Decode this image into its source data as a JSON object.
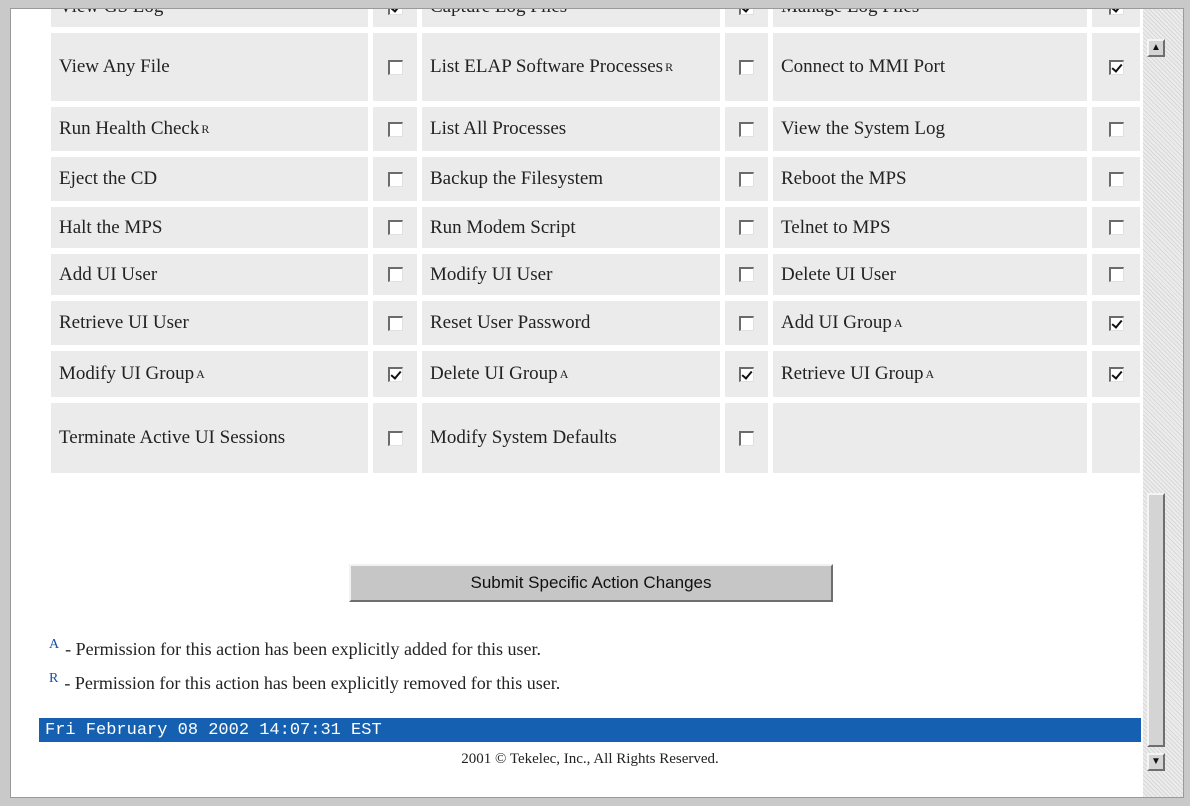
{
  "permissions": [
    [
      {
        "label": "View GS Log",
        "mark": "",
        "checked": true
      },
      {
        "label": "Capture Log Files",
        "mark": "",
        "checked": true
      },
      {
        "label": "Manage Log Files",
        "mark": "",
        "checked": true
      }
    ],
    [
      {
        "label": "View Any File",
        "mark": "",
        "checked": false
      },
      {
        "label": "List ELAP Software Processes",
        "mark": "R",
        "checked": false
      },
      {
        "label": "Connect to MMI Port",
        "mark": "",
        "checked": true
      }
    ],
    [
      {
        "label": "Run Health Check",
        "mark": "R",
        "checked": false
      },
      {
        "label": "List All Processes",
        "mark": "",
        "checked": false
      },
      {
        "label": "View the System Log",
        "mark": "",
        "checked": false
      }
    ],
    [
      {
        "label": "Eject the CD",
        "mark": "",
        "checked": false
      },
      {
        "label": "Backup the Filesystem",
        "mark": "",
        "checked": false
      },
      {
        "label": "Reboot the MPS",
        "mark": "",
        "checked": false
      }
    ],
    [
      {
        "label": "Halt the MPS",
        "mark": "",
        "checked": false
      },
      {
        "label": "Run Modem Script",
        "mark": "",
        "checked": false
      },
      {
        "label": "Telnet to MPS",
        "mark": "",
        "checked": false
      }
    ],
    [
      {
        "label": "Add UI User",
        "mark": "",
        "checked": false
      },
      {
        "label": "Modify UI User",
        "mark": "",
        "checked": false
      },
      {
        "label": "Delete UI User",
        "mark": "",
        "checked": false
      }
    ],
    [
      {
        "label": "Retrieve UI User",
        "mark": "",
        "checked": false
      },
      {
        "label": "Reset User Password",
        "mark": "",
        "checked": false
      },
      {
        "label": "Add UI Group",
        "mark": "A",
        "checked": true
      }
    ],
    [
      {
        "label": "Modify UI Group",
        "mark": "A",
        "checked": true
      },
      {
        "label": "Delete UI Group",
        "mark": "A",
        "checked": true
      },
      {
        "label": "Retrieve UI Group",
        "mark": "A",
        "checked": true
      }
    ],
    [
      {
        "label": "Terminate Active UI Sessions",
        "mark": "",
        "checked": false
      },
      {
        "label": "Modify System Defaults",
        "mark": "",
        "checked": false
      }
    ]
  ],
  "submit_label": "Submit Specific Action Changes",
  "legend": {
    "added_mark": "A",
    "added_text": "- Permission for this action has been explicitly added for this user.",
    "removed_mark": "R",
    "removed_text": "- Permission for this action has been explicitly removed for this user."
  },
  "status_bar": "Fri February 08 2002 14:07:31 EST",
  "copyright": "2001 © Tekelec, Inc., All Rights Reserved.",
  "colors": {
    "status_bar_bg": "#1560b0",
    "cell_bg": "#ebebeb",
    "legend_mark": "#1a4fa0"
  },
  "icons": {
    "scroll_up": "scroll-up-arrow-icon",
    "scroll_down": "scroll-down-arrow-icon"
  }
}
